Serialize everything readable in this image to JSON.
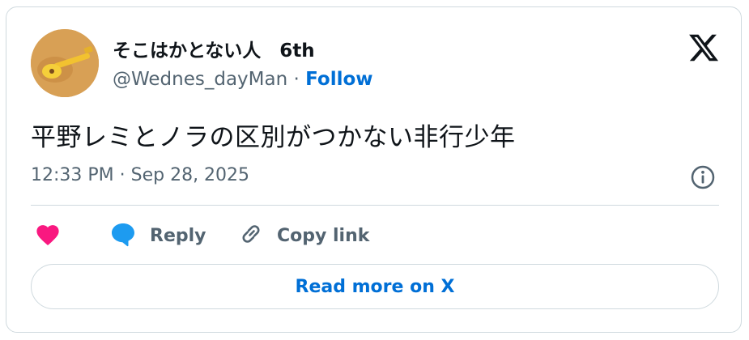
{
  "author": {
    "display_name": "そこはかとない人　6th",
    "handle": "@Wednes_dayMan",
    "separator": "·",
    "follow_label": "Follow"
  },
  "tweet": {
    "text": "平野レミとノラの区別がつかない非行少年",
    "timestamp": "12:33 PM · Sep 28, 2025"
  },
  "actions": {
    "like_label": "",
    "reply_label": "Reply",
    "copy_link_label": "Copy link"
  },
  "footer": {
    "read_more_label": "Read more on X"
  },
  "colors": {
    "accent": "#006fd6",
    "like": "#f91880",
    "reply_icon": "#1d9bf0",
    "secondary_text": "#536471",
    "primary_text": "#0f1419",
    "border": "#cfd9de"
  },
  "icons": {
    "brand": "x-logo-icon",
    "like": "heart-icon",
    "reply": "speech-bubble-icon",
    "copy": "link-icon",
    "info": "info-icon"
  }
}
